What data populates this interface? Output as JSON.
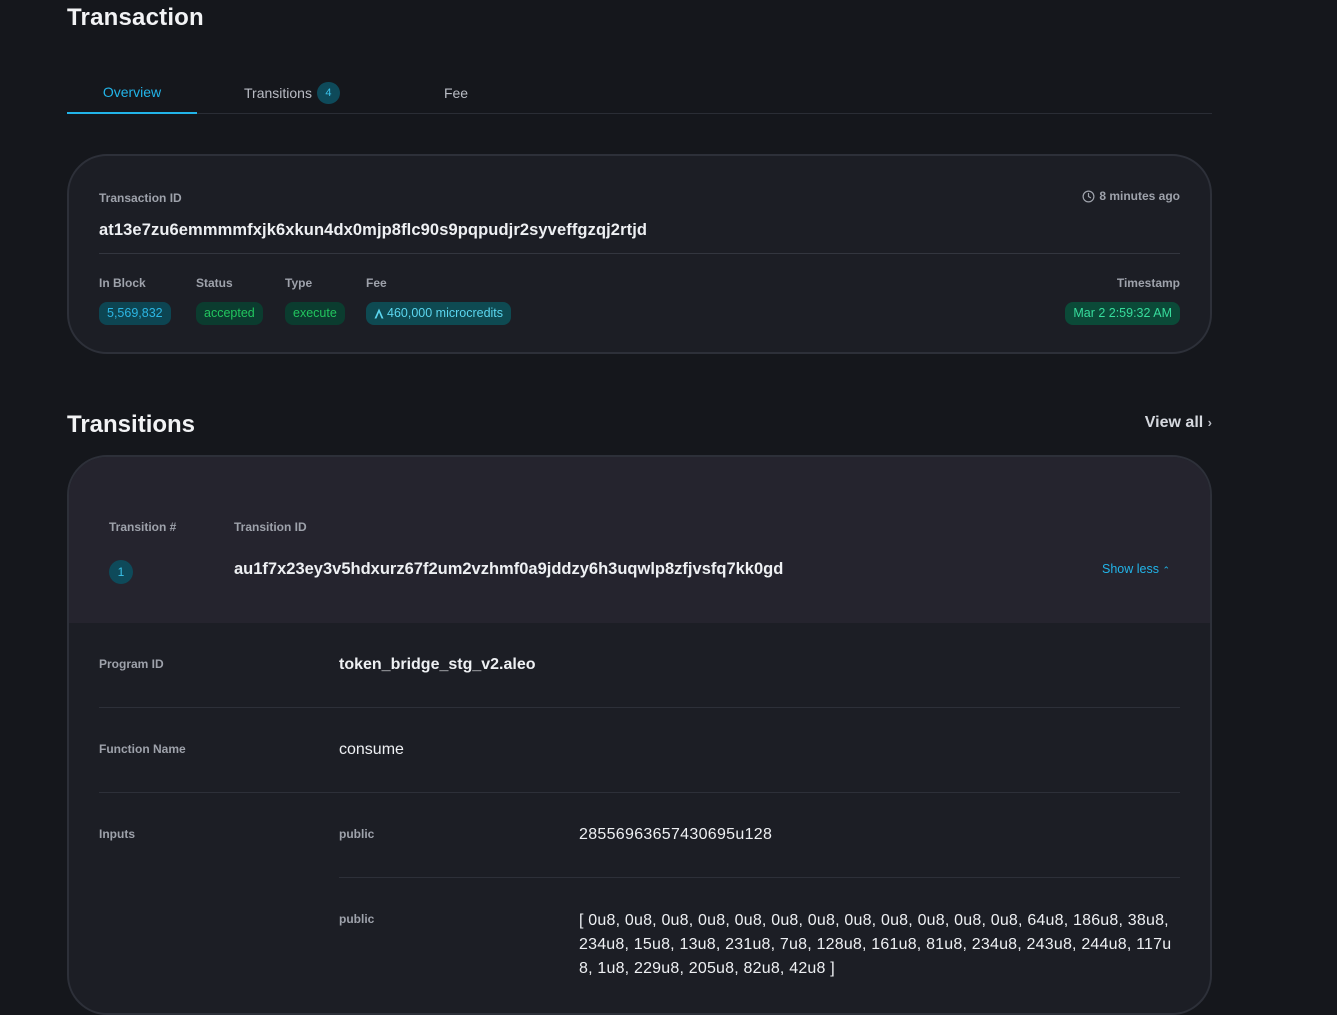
{
  "page": {
    "title": "Transaction"
  },
  "tabs": [
    {
      "label": "Overview"
    },
    {
      "label": "Transitions",
      "count": "4"
    },
    {
      "label": "Fee"
    }
  ],
  "summary": {
    "tx_id_label": "Transaction ID",
    "tx_id": "at13e7zu6emmmmfxjk6xkun4dx0mjp8flc90s9pqpudjr2syveffgzqj2rtjd",
    "age": "8 minutes ago",
    "in_block_label": "In Block",
    "in_block": "5,569,832",
    "status_label": "Status",
    "status": "accepted",
    "type_label": "Type",
    "type": "execute",
    "fee_label": "Fee",
    "fee": "460,000 microcredits",
    "timestamp_label": "Timestamp",
    "timestamp": "Mar 2 2:59:32 AM"
  },
  "transitions": {
    "title": "Transitions",
    "view_all": "View all",
    "col_num": "Transition #",
    "col_id": "Transition ID",
    "number": "1",
    "id": "au1f7x23ey3v5hdxurz67f2um2vzhmf0a9jddzy6h3uqwlp8zfjvsfq7kk0gd",
    "toggle": "Show less",
    "program_label": "Program ID",
    "program": "token_bridge_stg_v2.aleo",
    "function_label": "Function Name",
    "function": "consume",
    "inputs_label": "Inputs",
    "inputs": [
      {
        "visibility": "public",
        "value": "28556963657430695u128"
      },
      {
        "visibility": "public",
        "value": "[ 0u8, 0u8, 0u8, 0u8, 0u8, 0u8, 0u8, 0u8, 0u8, 0u8, 0u8, 0u8, 64u8, 186u8, 38u8, 234u8, 15u8, 13u8, 231u8, 7u8, 128u8, 161u8, 81u8, 234u8, 243u8, 244u8, 117u8, 1u8, 229u8, 205u8, 82u8, 42u8 ]"
      }
    ]
  },
  "colors": {
    "accent": "#22b4e8",
    "background": "#15171c",
    "card": "#1c1e25",
    "status_green": "#22c55e"
  }
}
